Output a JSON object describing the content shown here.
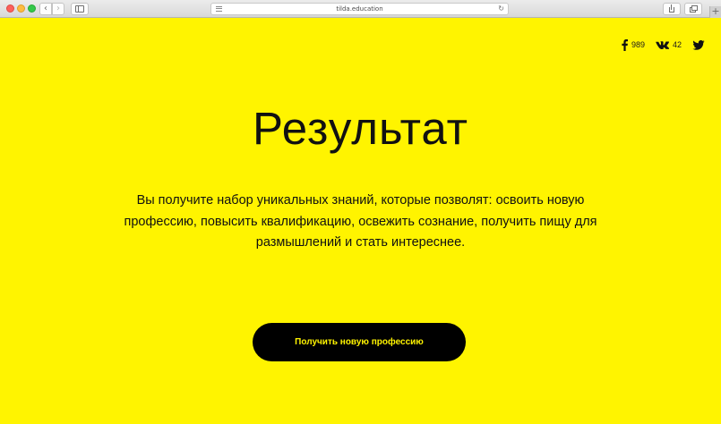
{
  "browser": {
    "url": "tilda.education"
  },
  "social": {
    "facebook": {
      "icon": "facebook-icon",
      "count": "989"
    },
    "vk": {
      "icon": "vk-icon",
      "count": "42"
    },
    "twitter": {
      "icon": "twitter-icon"
    }
  },
  "main": {
    "title": "Результат",
    "description": "Вы получите набор уникальных знаний, которые позволят: освоить новую профессию, повысить квалификацию, освежить сознание, получить пищу для размышлений и стать интереснее.",
    "cta_label": "Получить новую профессию"
  },
  "colors": {
    "background": "#fff400",
    "button": "#000000",
    "button_text": "#fff400"
  }
}
